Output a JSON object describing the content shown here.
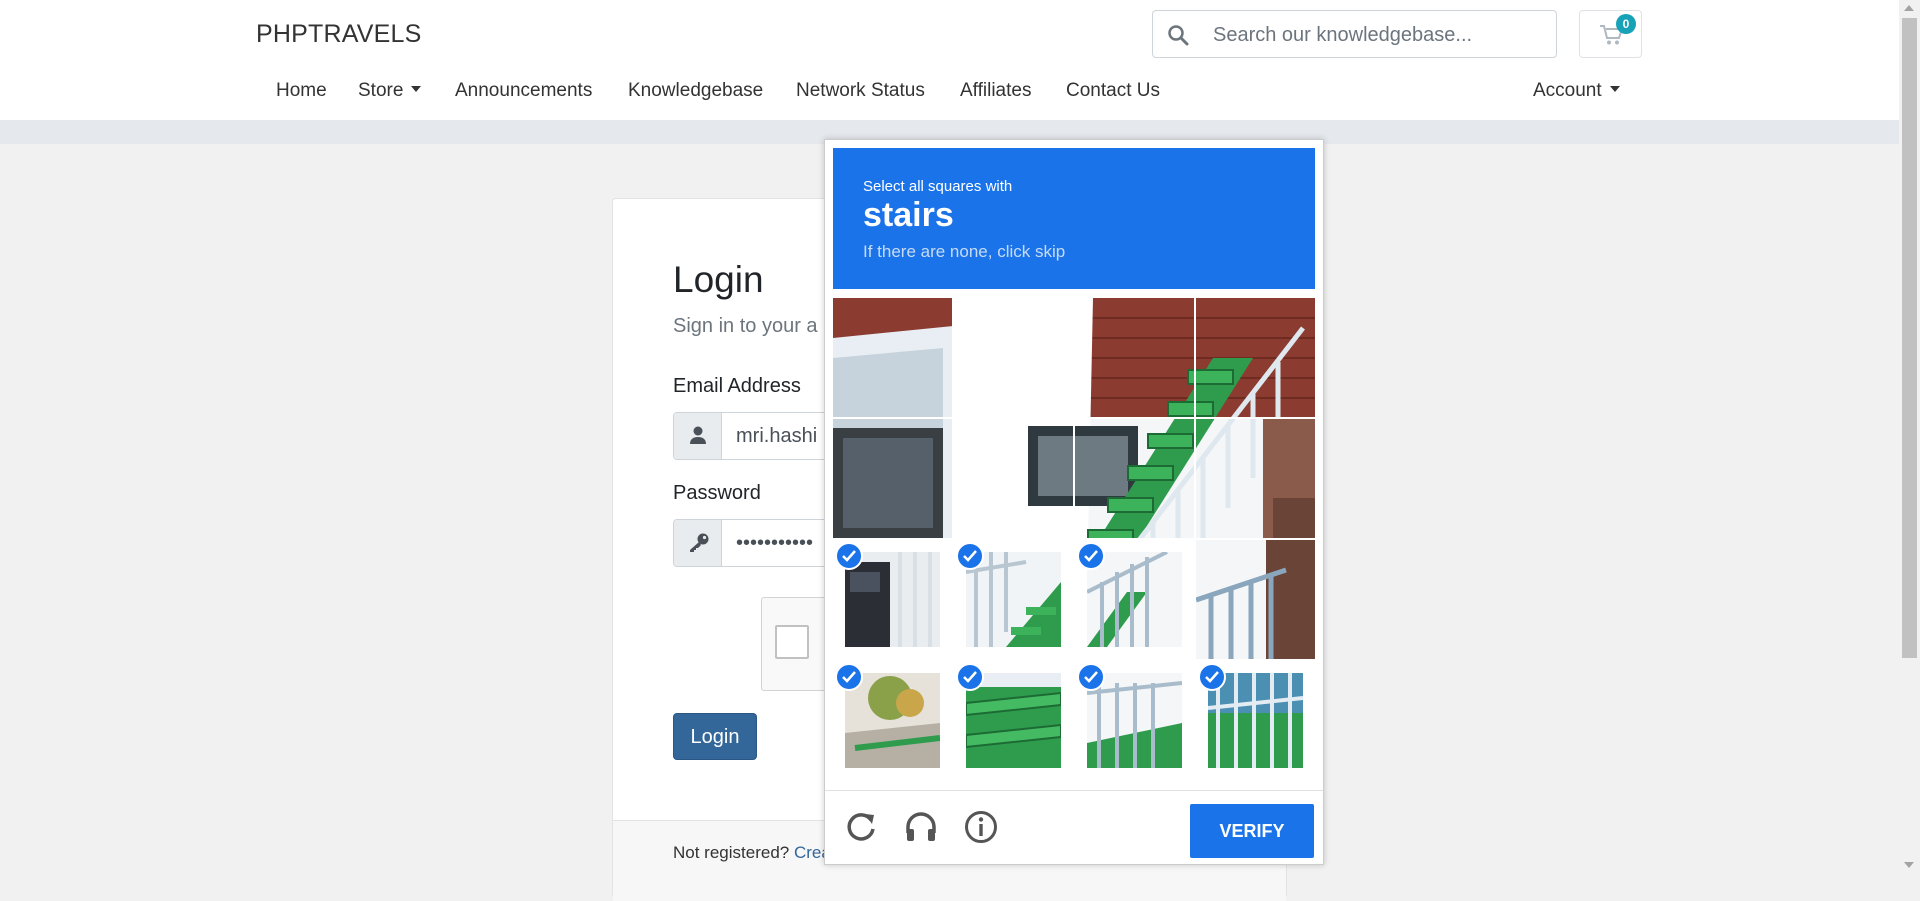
{
  "header": {
    "brand": "PHPTRAVELS",
    "search_placeholder": "Search our knowledgebase...",
    "cart_count": "0",
    "nav": [
      "Home",
      "Store",
      "Announcements",
      "Knowledgebase",
      "Network Status",
      "Affiliates",
      "Contact Us"
    ],
    "account": "Account"
  },
  "login": {
    "title": "Login",
    "subtitle": "Sign in to your a",
    "email_label": "Email Address",
    "email_value": "mri.hashi",
    "password_label": "Password",
    "password_value": "•••••••••••",
    "button": "Login",
    "footer_text": "Not registered? ",
    "footer_link": "Crea"
  },
  "captcha": {
    "instruction": "Select all squares with",
    "target": "stairs",
    "hint": "If there are none, click skip",
    "verify": "VERIFY",
    "icons": [
      "refresh-icon",
      "headphones-icon",
      "info-icon"
    ],
    "selected_tiles": [
      8,
      9,
      10,
      12,
      13,
      14,
      15
    ],
    "accent_color": "#1a73e8"
  },
  "colors": {
    "brand_blue": "#336699",
    "badge": "#17a2b8",
    "page_bg": "#f1f1f1"
  }
}
